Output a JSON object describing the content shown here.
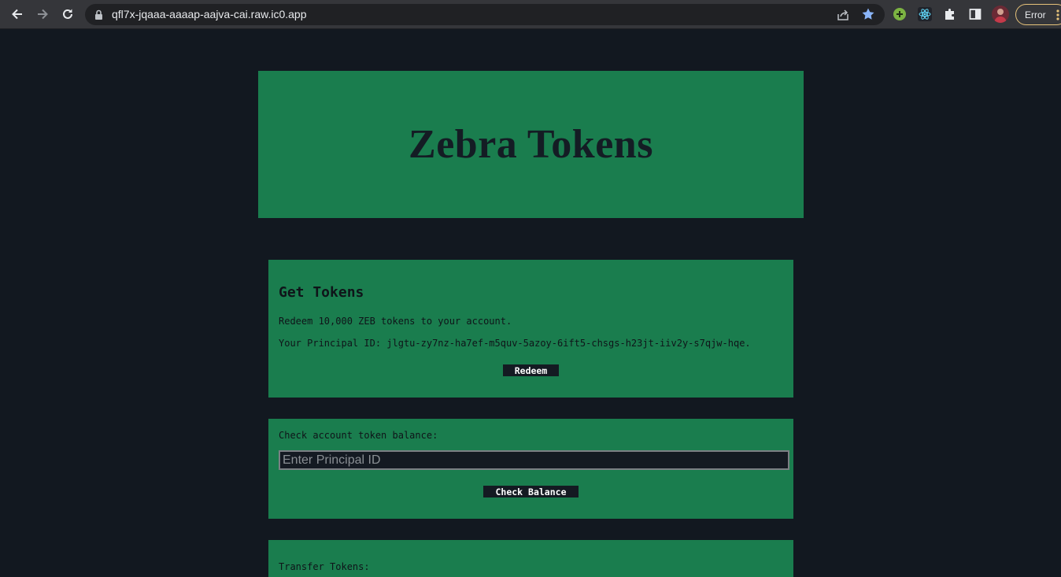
{
  "browser": {
    "url": "qfl7x-jqaaa-aaaap-aajva-cai.raw.ic0.app",
    "status_pill": "Error",
    "icons": [
      "back-arrow-icon",
      "forward-arrow-icon",
      "reload-icon",
      "lock-icon",
      "share-icon",
      "star-icon",
      "extension-plus-icon",
      "react-devtools-icon",
      "puzzle-icon",
      "sidepanel-icon",
      "avatar",
      "kebab-menu-icon"
    ],
    "colors": {
      "star": "#8ab4f8",
      "error_border": "#e6c27a"
    }
  },
  "page": {
    "title": "Zebra Tokens",
    "colors": {
      "background": "#121820",
      "card": "#1a7d4e",
      "button": "#141a22"
    },
    "get_tokens": {
      "heading": "Get Tokens",
      "description": "Redeem 10,000 ZEB tokens to your account.",
      "principal_line": "Your Principal ID: jlgtu-zy7nz-ha7ef-m5quv-5azoy-6ift5-chsgs-h23jt-iiv2y-s7qjw-hqe.",
      "button_label": "Redeem"
    },
    "balance": {
      "label": "Check account token balance:",
      "input_placeholder": "Enter Principal ID",
      "input_value": "",
      "button_label": "Check Balance"
    },
    "transfer": {
      "label": "Transfer Tokens:"
    }
  }
}
